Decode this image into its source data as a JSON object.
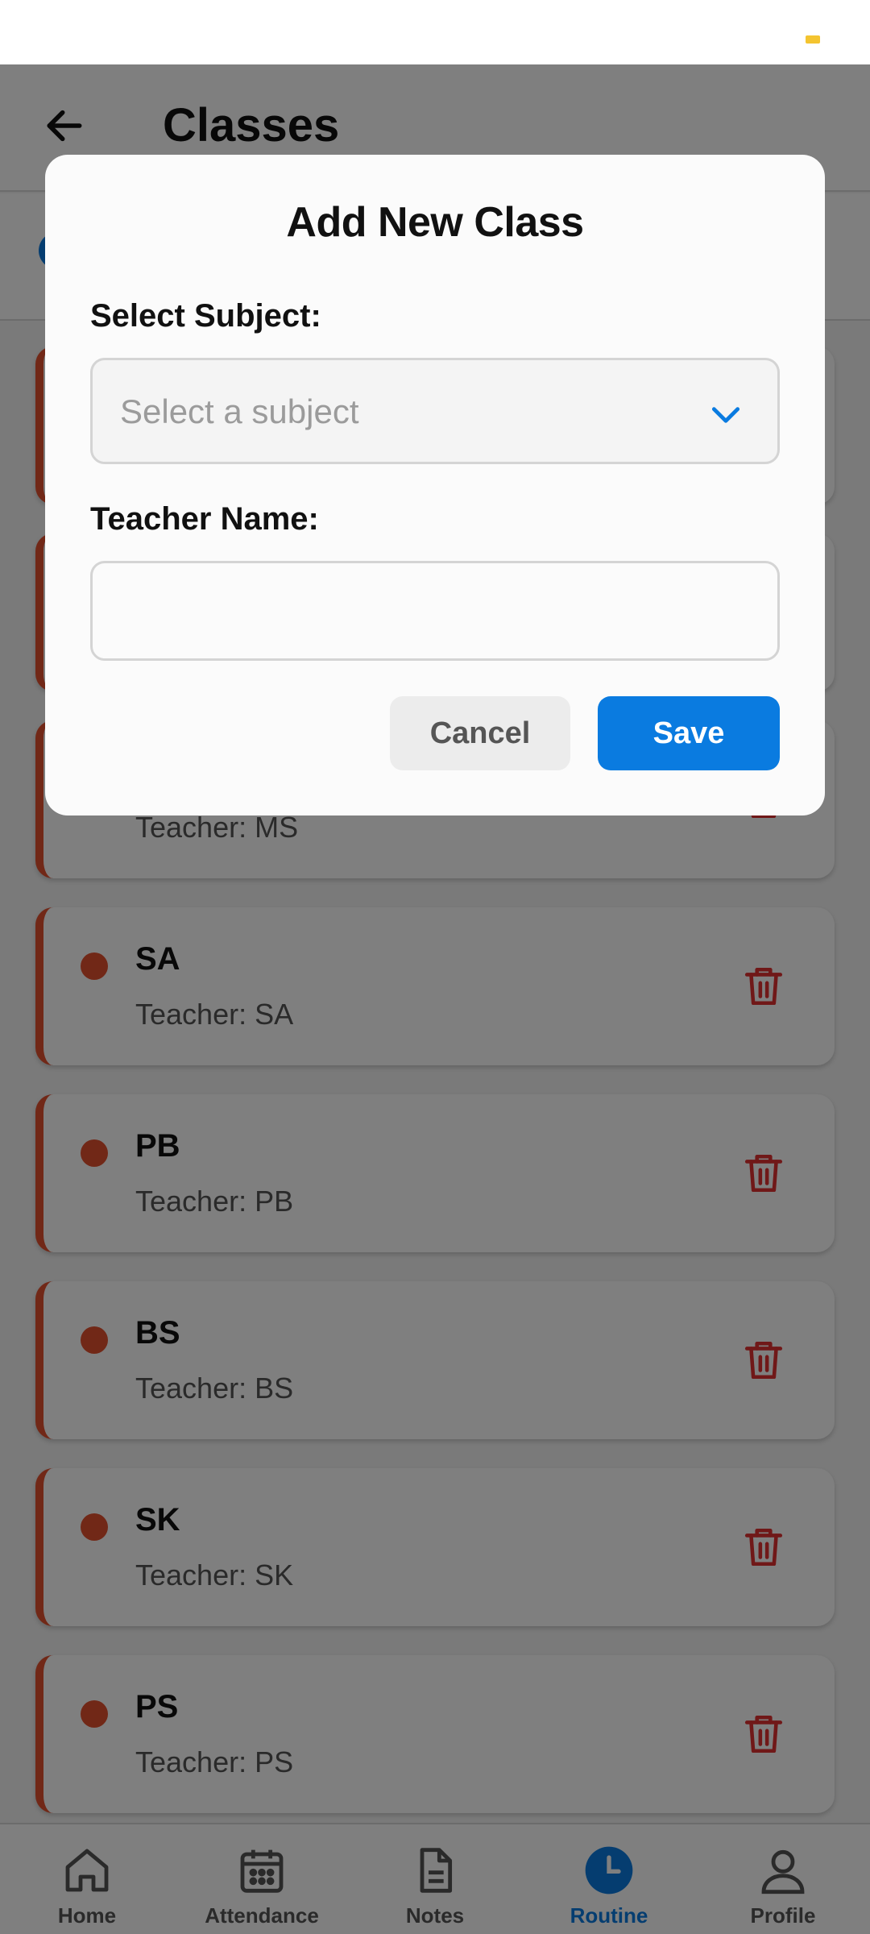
{
  "header": {
    "title": "Classes"
  },
  "classes": [
    {
      "name": "",
      "teacher": ""
    },
    {
      "name": "",
      "teacher": ""
    },
    {
      "name": "",
      "teacher": "Teacher: MS"
    },
    {
      "name": "SA",
      "teacher": "Teacher: SA"
    },
    {
      "name": "PB",
      "teacher": "Teacher: PB"
    },
    {
      "name": "BS",
      "teacher": "Teacher: BS"
    },
    {
      "name": "SK",
      "teacher": "Teacher: SK"
    },
    {
      "name": "PS",
      "teacher": "Teacher: PS"
    }
  ],
  "modal": {
    "title": "Add New Class",
    "subject_label": "Select Subject:",
    "subject_placeholder": "Select a subject",
    "teacher_label": "Teacher Name:",
    "teacher_value": "",
    "cancel_label": "Cancel",
    "save_label": "Save"
  },
  "nav": {
    "home": "Home",
    "attendance": "Attendance",
    "notes": "Notes",
    "routine": "Routine",
    "profile": "Profile",
    "active": "routine"
  },
  "colors": {
    "accent": "#0a7be0",
    "card_accent": "#e3502f",
    "delete": "#e03131"
  }
}
